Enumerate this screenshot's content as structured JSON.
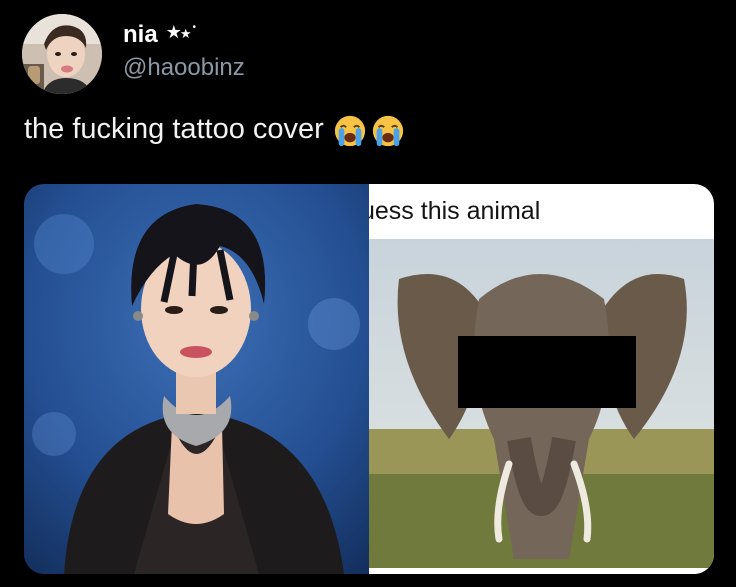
{
  "post": {
    "display_name": "nia",
    "name_stars": "★",
    "name_stars_small": "★",
    "name_dot": "•",
    "handle": "@haoobinz",
    "text": "the fucking tattoo cover",
    "emoji": [
      "loudly-crying-face",
      "loudly-crying-face"
    ]
  },
  "media": {
    "left_image": "performer-portrait-photo",
    "right_image": {
      "caption": "uess this animal",
      "subject": "elephant-photo",
      "censor": "black-censor-bar"
    }
  },
  "colors": {
    "background": "#000000",
    "text": "#e7e9ea",
    "handle": "#8b98a5",
    "emoji_face": "#f6c344",
    "emoji_tears": "#4aa3e8"
  }
}
